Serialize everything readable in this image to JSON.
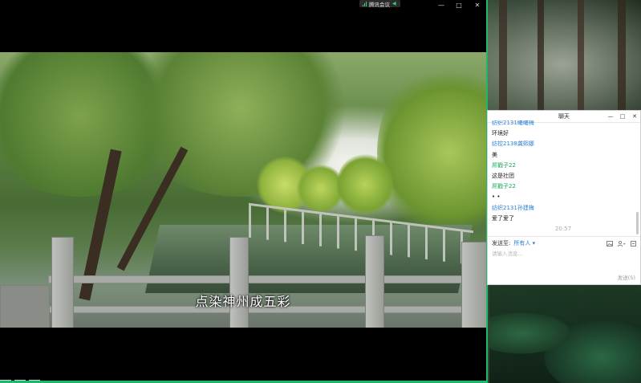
{
  "meeting": {
    "app_name": "腾讯会议",
    "subtitle": "点染神州成五彩",
    "window_controls": {
      "minimize": "—",
      "maximize": "□",
      "close": "✕"
    }
  },
  "chat": {
    "title": "聊天",
    "window_controls": {
      "minimize": "—",
      "maximize": "□",
      "close": "✕"
    },
    "messages": [
      {
        "sender": "纺织2131曦曦梅",
        "text": "环境好",
        "sender_color": "blue"
      },
      {
        "sender": "纺控2138龚熙娜",
        "text": "美",
        "sender_color": "blue"
      },
      {
        "sender": "屌戳子22",
        "text": "这是社团",
        "sender_color": "green"
      },
      {
        "sender": "屌戳子22",
        "text": "• •",
        "sender_color": "green"
      },
      {
        "sender": "纺织2131孙建梅",
        "text": "爱了爱了",
        "sender_color": "blue"
      }
    ],
    "timestamp": "20:57",
    "send_to_label": "发送至:",
    "recipient": "所有人 ▾",
    "input_placeholder": "请输入消息...",
    "send_button": "发送(S)",
    "icons": [
      "image-icon",
      "user-mention-icon",
      "more-icon"
    ]
  },
  "colors": {
    "accent_green": "#1fb86b",
    "sender_blue": "#2a7fd4",
    "sender_green": "#1aa85a"
  }
}
